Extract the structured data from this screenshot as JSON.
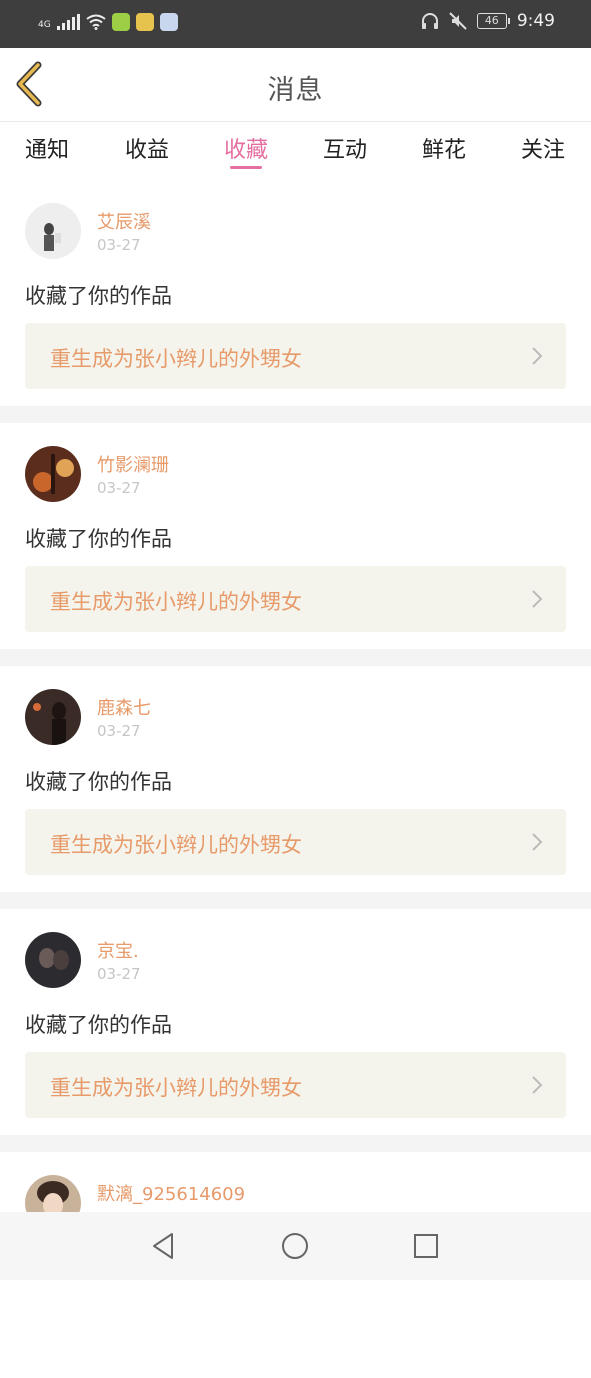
{
  "status_bar": {
    "network": "4G",
    "battery": "46",
    "time": "9:49",
    "icons": [
      "signal-icon",
      "wifi-icon",
      "app-icon-1",
      "app-icon-2",
      "app-icon-3",
      "headset-icon",
      "mute-icon",
      "battery-icon"
    ]
  },
  "header": {
    "title": "消息",
    "back_icon": "chevron-left-icon",
    "accent": "#e6b84f"
  },
  "tabs": {
    "items": [
      "通知",
      "收益",
      "收藏",
      "互动",
      "鲜花",
      "关注"
    ],
    "active_index": 2,
    "active_color": "#e46fa0"
  },
  "messages": [
    {
      "user": "艾辰溪",
      "date": "03-27",
      "action": "收藏了你的作品",
      "work": "重生成为张小辫儿的外甥女"
    },
    {
      "user": "竹影澜珊",
      "date": "03-27",
      "action": "收藏了你的作品",
      "work": "重生成为张小辫儿的外甥女"
    },
    {
      "user": "鹿森七",
      "date": "03-27",
      "action": "收藏了你的作品",
      "work": "重生成为张小辫儿的外甥女"
    },
    {
      "user": "京宝.",
      "date": "03-27",
      "action": "收藏了你的作品",
      "work": "重生成为张小辫儿的外甥女"
    },
    {
      "user": "默漓_925614609",
      "date": "",
      "action": "",
      "work": ""
    }
  ],
  "colors": {
    "username": "#e79a6a",
    "work_bg": "#f5f4ec",
    "separator": "#f4f4f4"
  },
  "nav_bar": {
    "icons": [
      "back-triangle-icon",
      "home-circle-icon",
      "recents-square-icon"
    ]
  }
}
